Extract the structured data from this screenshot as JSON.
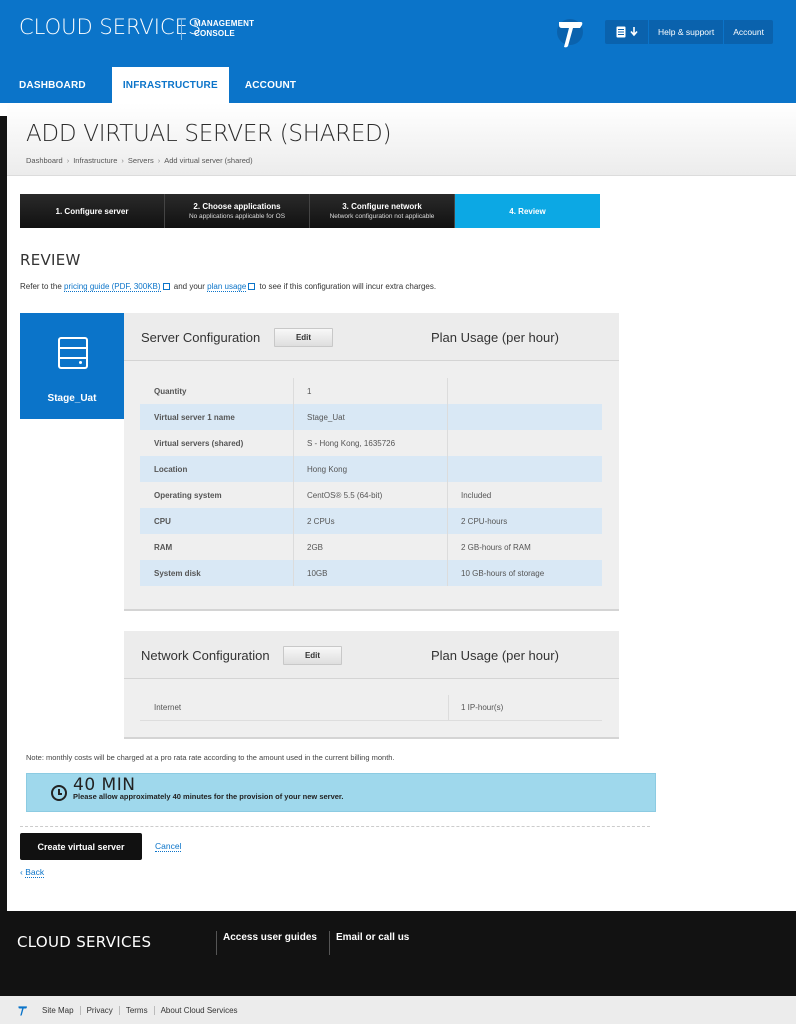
{
  "header": {
    "brand": "CLOUD SERVICES",
    "subtitle_line1": "MANAGEMENT",
    "subtitle_line2": "CONSOLE",
    "util": {
      "help": "Help & support",
      "account": "Account"
    },
    "nav": [
      {
        "label": "DASHBOARD"
      },
      {
        "label": "INFRASTRUCTURE"
      },
      {
        "label": "ACCOUNT"
      }
    ]
  },
  "page": {
    "title": "ADD VIRTUAL SERVER (SHARED)",
    "breadcrumb": [
      "Dashboard",
      "Infrastructure",
      "Servers",
      "Add virtual server (shared)"
    ]
  },
  "steps": [
    {
      "title": "1. Configure server",
      "sub": ""
    },
    {
      "title": "2. Choose applications",
      "sub": "No applications applicable for OS"
    },
    {
      "title": "3. Configure network",
      "sub": "Network configuration not applicable"
    },
    {
      "title": "4. Review",
      "sub": ""
    }
  ],
  "review": {
    "heading": "REVIEW",
    "intro_pre": "Refer to the",
    "pricing_link": "pricing guide (PDF, 300KB)",
    "intro_mid": "and your",
    "usage_link": "plan usage",
    "intro_post": "to see if this configuration will incur extra charges."
  },
  "server_card": {
    "name": "Stage_Uat"
  },
  "server_config": {
    "title": "Server Configuration",
    "edit": "Edit",
    "usage_title": "Plan Usage (per hour)",
    "rows": [
      {
        "label": "Quantity",
        "value": "1",
        "usage": ""
      },
      {
        "label": "Virtual server 1 name",
        "value": "Stage_Uat",
        "usage": ""
      },
      {
        "label": "Virtual servers (shared)",
        "value": "S - Hong Kong, 1635726",
        "usage": ""
      },
      {
        "label": "Location",
        "value": "Hong Kong",
        "usage": ""
      },
      {
        "label": "Operating system",
        "value": "CentOS® 5.5 (64-bit)",
        "usage": "Included"
      },
      {
        "label": "CPU",
        "value": "2 CPUs",
        "usage": "2 CPU-hours"
      },
      {
        "label": "RAM",
        "value": "2GB",
        "usage": "2 GB-hours of RAM"
      },
      {
        "label": "System disk",
        "value": "10GB",
        "usage": "10 GB-hours of storage"
      }
    ]
  },
  "network_config": {
    "title": "Network Configuration",
    "edit": "Edit",
    "usage_title": "Plan Usage (per hour)",
    "rows": [
      {
        "label": "Internet",
        "value": "",
        "usage": "1 IP-hour(s)"
      }
    ]
  },
  "note": "Note: monthly costs will be charged at a pro rata rate according to the amount used in the current billing month.",
  "info": {
    "big": "40 MIN",
    "text": "Please allow approximately 40 minutes for the provision of your new server."
  },
  "actions": {
    "create": "Create virtual server",
    "cancel": "Cancel",
    "back": "Back"
  },
  "footer": {
    "brand": "CLOUD SERVICES",
    "link1": "Access user guides",
    "link2": "Email or call us",
    "bottom": [
      "Site Map",
      "Privacy",
      "Terms",
      "About Cloud Services"
    ]
  },
  "colors": {
    "primary": "#0b74c9",
    "active_step": "#0ca8e4",
    "info_bg": "#9fd8ec"
  }
}
